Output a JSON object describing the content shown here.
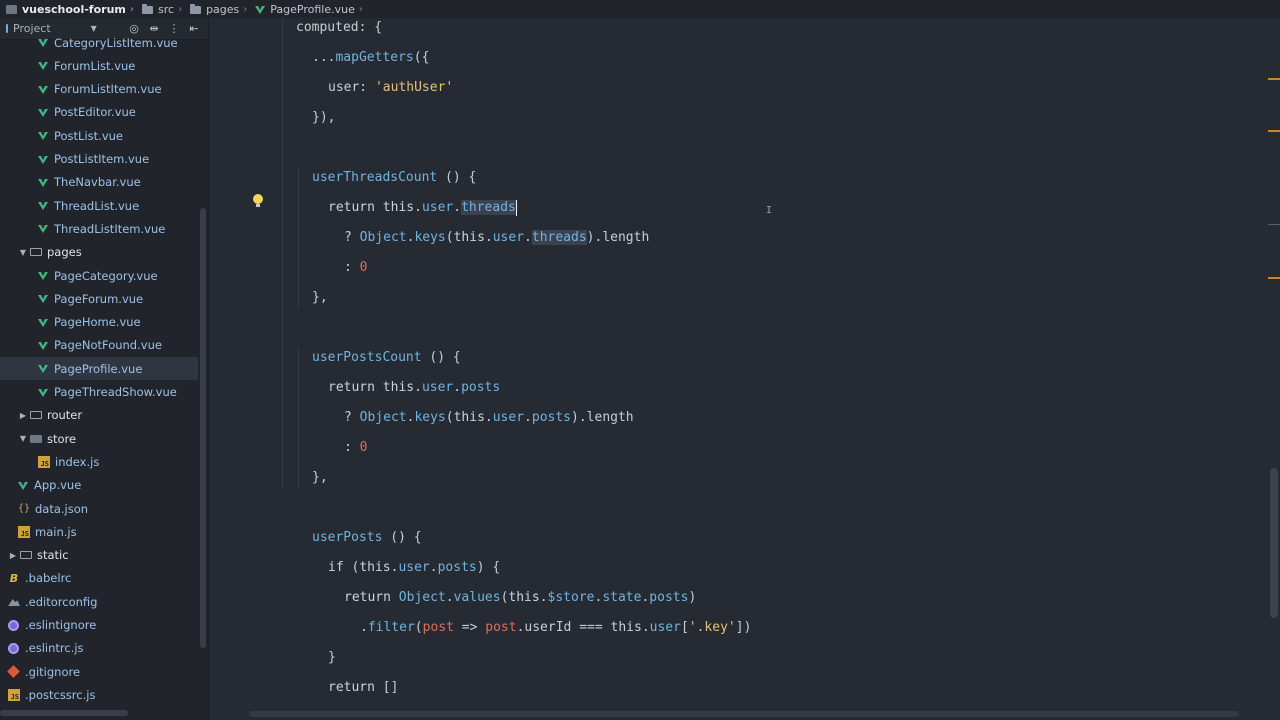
{
  "breadcrumb": {
    "project": "vueschool-forum",
    "items": [
      "src",
      "pages",
      "PageProfile.vue"
    ]
  },
  "sidebar": {
    "title": "Project",
    "tools": [
      "◎",
      "⇹",
      "⋮",
      "⇤"
    ],
    "items": [
      {
        "label": "CategoryListItem.vue",
        "type": "vue",
        "depth": 3
      },
      {
        "label": "ForumList.vue",
        "type": "vue",
        "depth": 3
      },
      {
        "label": "ForumListItem.vue",
        "type": "vue",
        "depth": 3
      },
      {
        "label": "PostEditor.vue",
        "type": "vue",
        "depth": 3
      },
      {
        "label": "PostList.vue",
        "type": "vue",
        "depth": 3
      },
      {
        "label": "PostListItem.vue",
        "type": "vue",
        "depth": 3
      },
      {
        "label": "TheNavbar.vue",
        "type": "vue",
        "depth": 3
      },
      {
        "label": "ThreadList.vue",
        "type": "vue",
        "depth": 3
      },
      {
        "label": "ThreadListItem.vue",
        "type": "vue",
        "depth": 3
      },
      {
        "label": "pages",
        "type": "folder-open",
        "depth": 2
      },
      {
        "label": "PageCategory.vue",
        "type": "vue",
        "depth": 3
      },
      {
        "label": "PageForum.vue",
        "type": "vue",
        "depth": 3
      },
      {
        "label": "PageHome.vue",
        "type": "vue",
        "depth": 3
      },
      {
        "label": "PageNotFound.vue",
        "type": "vue",
        "depth": 3
      },
      {
        "label": "PageProfile.vue",
        "type": "vue",
        "depth": 3,
        "selected": true
      },
      {
        "label": "PageThreadShow.vue",
        "type": "vue",
        "depth": 3
      },
      {
        "label": "router",
        "type": "folder-closed",
        "depth": 2
      },
      {
        "label": "store",
        "type": "folder-open-filled",
        "depth": 2
      },
      {
        "label": "index.js",
        "type": "js",
        "depth": 3
      },
      {
        "label": "App.vue",
        "type": "vue",
        "depth": 2
      },
      {
        "label": "data.json",
        "type": "json",
        "depth": 2
      },
      {
        "label": "main.js",
        "type": "js",
        "depth": 2
      },
      {
        "label": "static",
        "type": "folder-closed",
        "depth": 1
      },
      {
        "label": ".babelrc",
        "type": "babel",
        "depth": 1
      },
      {
        "label": ".editorconfig",
        "type": "config",
        "depth": 1
      },
      {
        "label": ".eslintignore",
        "type": "eslint",
        "depth": 1
      },
      {
        "label": ".eslintrc.js",
        "type": "eslint",
        "depth": 1
      },
      {
        "label": ".gitignore",
        "type": "git",
        "depth": 1
      },
      {
        "label": ".postcssrc.js",
        "type": "js",
        "depth": 1
      }
    ]
  },
  "editor": {
    "cursor_line": 7,
    "lines": [
      {
        "indent": 0,
        "tokens": [
          [
            "plain",
            "computed: {"
          ]
        ]
      },
      {
        "indent": 1,
        "tokens": [
          [
            "plain",
            "..."
          ],
          [
            "fn",
            "mapGetters"
          ],
          [
            "plain",
            "({"
          ]
        ]
      },
      {
        "indent": 2,
        "tokens": [
          [
            "plain",
            "user: "
          ],
          [
            "str",
            "'authUser'"
          ]
        ]
      },
      {
        "indent": 1,
        "tokens": [
          [
            "plain",
            "}),"
          ]
        ]
      },
      {
        "indent": 0,
        "tokens": []
      },
      {
        "indent": 1,
        "tokens": [
          [
            "fn",
            "userThreadsCount"
          ],
          [
            "plain",
            " () {"
          ]
        ]
      },
      {
        "indent": 2,
        "tokens": [
          [
            "kw",
            "return "
          ],
          [
            "kw",
            "this"
          ],
          [
            "plain",
            "."
          ],
          [
            "prop",
            "user"
          ],
          [
            "plain",
            "."
          ],
          [
            "hlprop",
            "threads"
          ],
          [
            "cursor",
            ""
          ]
        ]
      },
      {
        "indent": 3,
        "tokens": [
          [
            "plain",
            "? "
          ],
          [
            "fn",
            "Object"
          ],
          [
            "plain",
            "."
          ],
          [
            "fn",
            "keys"
          ],
          [
            "plain",
            "("
          ],
          [
            "kw",
            "this"
          ],
          [
            "plain",
            "."
          ],
          [
            "prop",
            "user"
          ],
          [
            "plain",
            "."
          ],
          [
            "hlprop",
            "threads"
          ],
          [
            "plain",
            ")."
          ],
          [
            "plain",
            "length"
          ]
        ]
      },
      {
        "indent": 3,
        "tokens": [
          [
            "plain",
            ": "
          ],
          [
            "num",
            "0"
          ]
        ]
      },
      {
        "indent": 1,
        "tokens": [
          [
            "plain",
            "},"
          ]
        ]
      },
      {
        "indent": 0,
        "tokens": []
      },
      {
        "indent": 1,
        "tokens": [
          [
            "fn",
            "userPostsCount"
          ],
          [
            "plain",
            " () {"
          ]
        ]
      },
      {
        "indent": 2,
        "tokens": [
          [
            "kw",
            "return "
          ],
          [
            "kw",
            "this"
          ],
          [
            "plain",
            "."
          ],
          [
            "prop",
            "user"
          ],
          [
            "plain",
            "."
          ],
          [
            "prop",
            "posts"
          ]
        ]
      },
      {
        "indent": 3,
        "tokens": [
          [
            "plain",
            "? "
          ],
          [
            "fn",
            "Object"
          ],
          [
            "plain",
            "."
          ],
          [
            "fn",
            "keys"
          ],
          [
            "plain",
            "("
          ],
          [
            "kw",
            "this"
          ],
          [
            "plain",
            "."
          ],
          [
            "prop",
            "user"
          ],
          [
            "plain",
            "."
          ],
          [
            "prop",
            "posts"
          ],
          [
            "plain",
            ")."
          ],
          [
            "plain",
            "length"
          ]
        ]
      },
      {
        "indent": 3,
        "tokens": [
          [
            "plain",
            ": "
          ],
          [
            "num",
            "0"
          ]
        ]
      },
      {
        "indent": 1,
        "tokens": [
          [
            "plain",
            "},"
          ]
        ]
      },
      {
        "indent": 0,
        "tokens": []
      },
      {
        "indent": 1,
        "tokens": [
          [
            "fn",
            "userPosts"
          ],
          [
            "plain",
            " () {"
          ]
        ]
      },
      {
        "indent": 2,
        "tokens": [
          [
            "kw",
            "if "
          ],
          [
            "plain",
            "("
          ],
          [
            "kw",
            "this"
          ],
          [
            "plain",
            "."
          ],
          [
            "prop",
            "user"
          ],
          [
            "plain",
            "."
          ],
          [
            "prop",
            "posts"
          ],
          [
            "plain",
            ") {"
          ]
        ]
      },
      {
        "indent": 3,
        "tokens": [
          [
            "kw",
            "return "
          ],
          [
            "fn",
            "Object"
          ],
          [
            "plain",
            "."
          ],
          [
            "fn",
            "values"
          ],
          [
            "plain",
            "("
          ],
          [
            "kw",
            "this"
          ],
          [
            "plain",
            "."
          ],
          [
            "prop",
            "$store"
          ],
          [
            "plain",
            "."
          ],
          [
            "prop",
            "state"
          ],
          [
            "plain",
            "."
          ],
          [
            "prop",
            "posts"
          ],
          [
            "plain",
            ")"
          ]
        ]
      },
      {
        "indent": 4,
        "tokens": [
          [
            "plain",
            "."
          ],
          [
            "fn",
            "filter"
          ],
          [
            "plain",
            "("
          ],
          [
            "num",
            "post"
          ],
          [
            "plain",
            " => "
          ],
          [
            "num",
            "post"
          ],
          [
            "plain",
            "."
          ],
          [
            "plain",
            "userId "
          ],
          [
            "plain",
            "=== "
          ],
          [
            "kw",
            "this"
          ],
          [
            "plain",
            "."
          ],
          [
            "prop",
            "user"
          ],
          [
            "plain",
            "["
          ],
          [
            "str",
            "'.key'"
          ],
          [
            "plain",
            "])"
          ]
        ]
      },
      {
        "indent": 2,
        "tokens": [
          [
            "plain",
            "}"
          ]
        ]
      },
      {
        "indent": 2,
        "tokens": [
          [
            "kw",
            "return "
          ],
          [
            "plain",
            "[]"
          ]
        ]
      }
    ]
  },
  "colors": {
    "background": "#262b33",
    "sidebar": "#21252b",
    "accent_vue": "#41b883",
    "marker": "#c9862d"
  }
}
